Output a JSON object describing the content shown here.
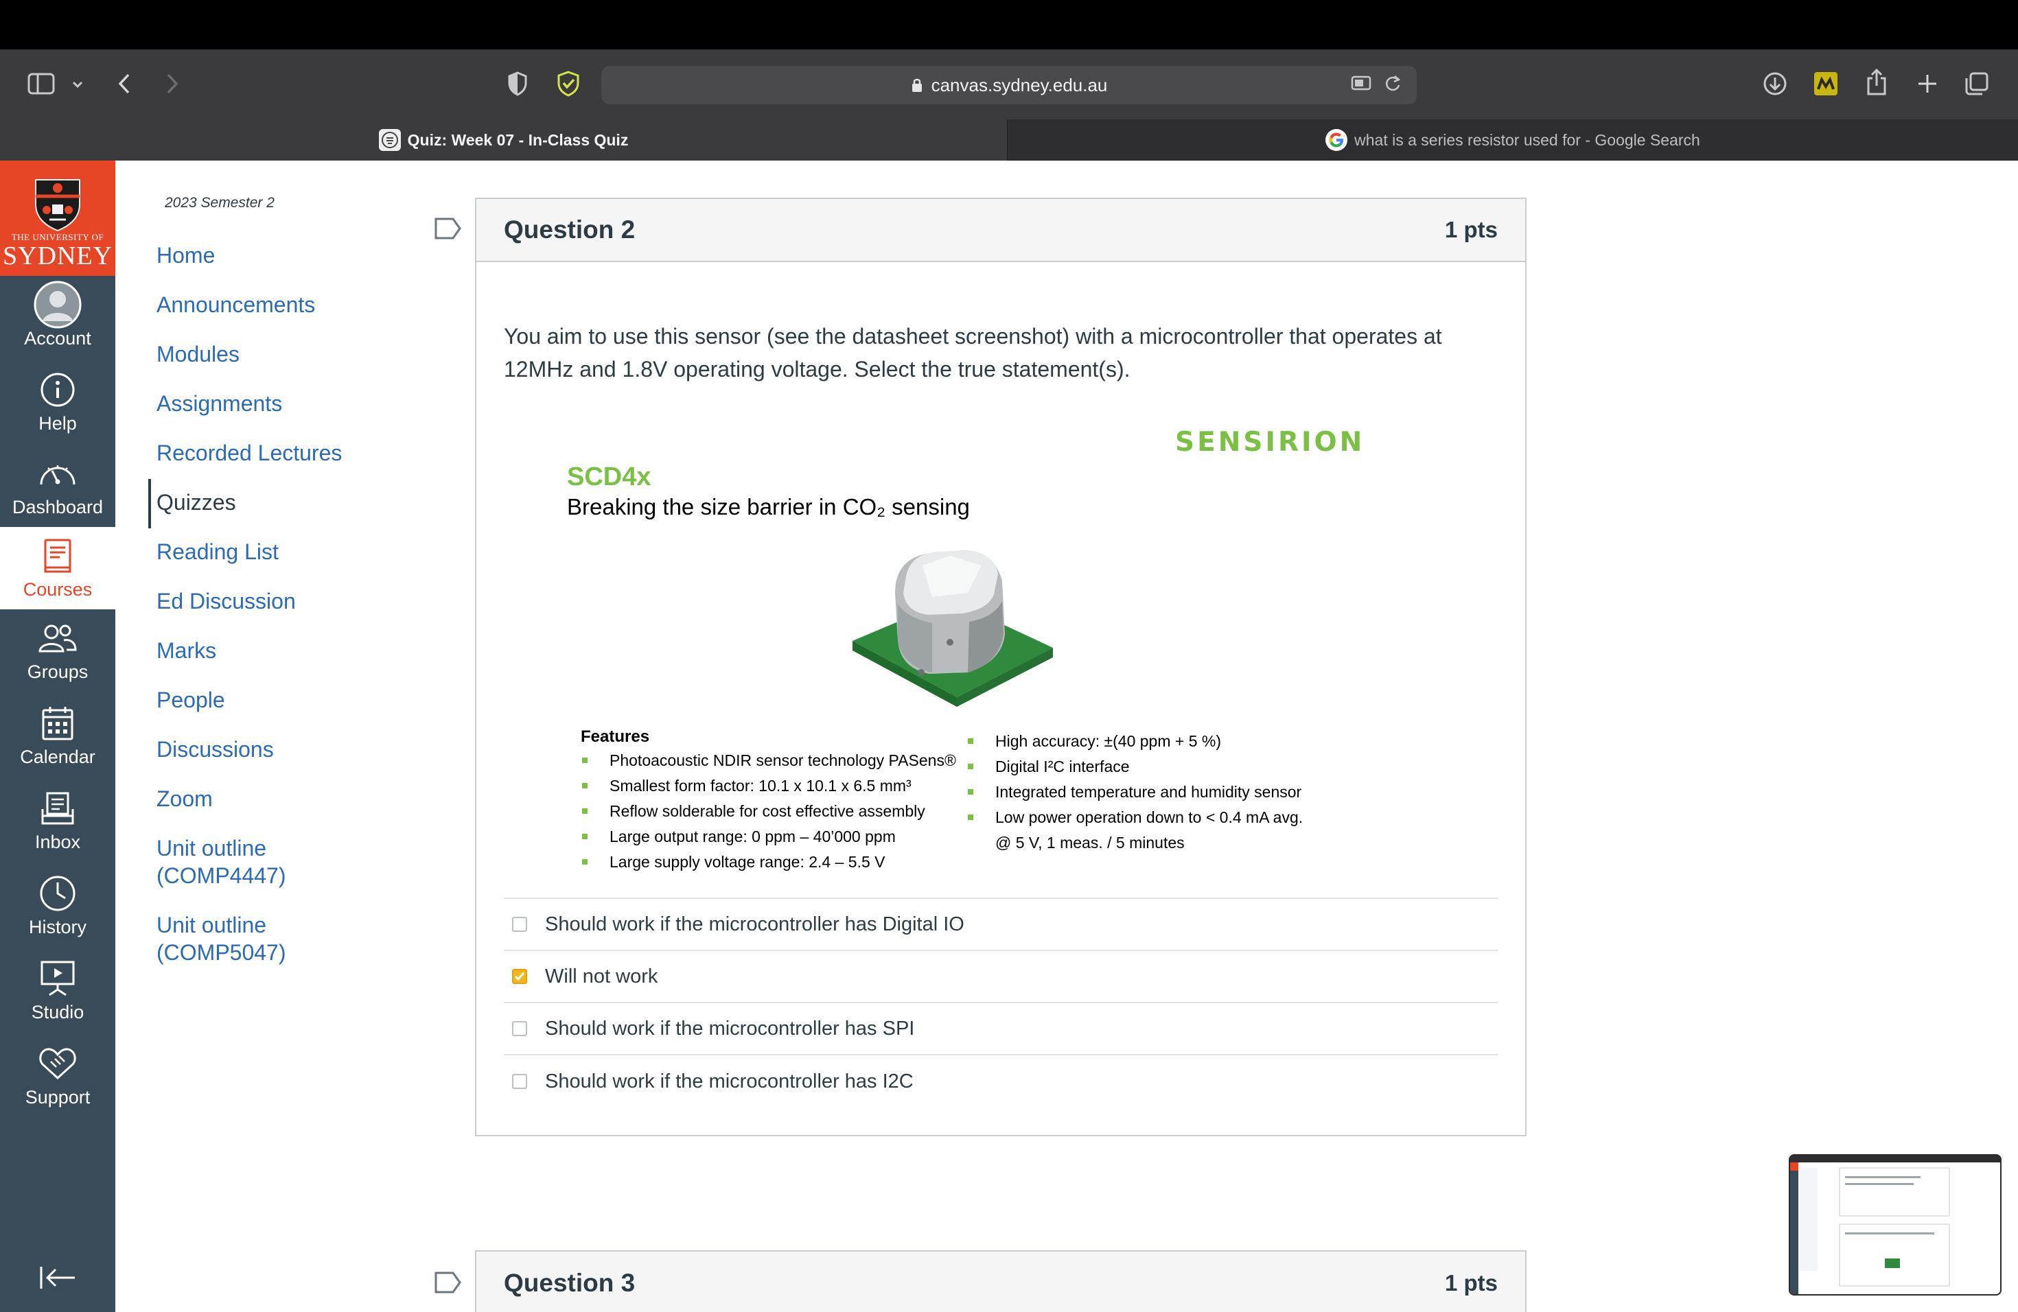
{
  "browser": {
    "url": "canvas.sydney.edu.au",
    "tabs": [
      {
        "label": "Quiz: Week 07 - In-Class Quiz",
        "active": true
      },
      {
        "label": "what is a series resistor used for - Google Search",
        "active": false
      }
    ]
  },
  "global_nav": {
    "logo_small": "THE UNIVERSITY OF",
    "logo_big": "SYDNEY",
    "items": [
      {
        "label": "Account",
        "icon": "account-avatar-icon"
      },
      {
        "label": "Help",
        "icon": "help-icon"
      },
      {
        "label": "Dashboard",
        "icon": "dashboard-icon"
      },
      {
        "label": "Courses",
        "icon": "courses-icon",
        "active": true
      },
      {
        "label": "Groups",
        "icon": "groups-icon"
      },
      {
        "label": "Calendar",
        "icon": "calendar-icon"
      },
      {
        "label": "Inbox",
        "icon": "inbox-icon"
      },
      {
        "label": "History",
        "icon": "history-icon"
      },
      {
        "label": "Studio",
        "icon": "studio-icon"
      },
      {
        "label": "Support",
        "icon": "support-icon"
      }
    ],
    "accent": "#e64626",
    "background": "#394b58"
  },
  "course_nav": {
    "term": "2023 Semester 2",
    "items": [
      {
        "label": "Home"
      },
      {
        "label": "Announcements"
      },
      {
        "label": "Modules"
      },
      {
        "label": "Assignments"
      },
      {
        "label": "Recorded Lectures"
      },
      {
        "label": "Quizzes",
        "active": true
      },
      {
        "label": "Reading List"
      },
      {
        "label": "Ed Discussion"
      },
      {
        "label": "Marks"
      },
      {
        "label": "People"
      },
      {
        "label": "Discussions"
      },
      {
        "label": "Zoom"
      },
      {
        "label": "Unit outline (COMP4447)"
      },
      {
        "label": "Unit outline (COMP5047)"
      }
    ]
  },
  "question2": {
    "title": "Question 2",
    "points": "1 pts",
    "text": "You aim to use this sensor (see the datasheet screenshot) with a microcontroller that operates at 12MHz and 1.8V operating voltage. Select the true statement(s).",
    "datasheet": {
      "brand": "SENSIRION",
      "product": "SCD4x",
      "tagline": "Breaking the size barrier in CO₂ sensing",
      "features_heading": "Features",
      "features_left": [
        "Photoacoustic NDIR sensor technology PASens®",
        "Smallest form factor: 10.1 x 10.1 x 6.5 mm³",
        "Reflow solderable for cost effective assembly",
        "Large output range: 0 ppm – 40’000 ppm",
        "Large supply voltage range: 2.4 – 5.5 V"
      ],
      "features_right": [
        "High accuracy: ±(40 ppm + 5 %)",
        "Digital I²C interface",
        "Integrated temperature and humidity sensor",
        "Low power operation down to < 0.4 mA avg.",
        "@ 5 V, 1 meas. / 5 minutes"
      ],
      "brand_color": "#7ac143"
    },
    "answers": [
      {
        "label": "Should work if the microcontroller has Digital IO",
        "checked": false
      },
      {
        "label": "Will not work",
        "checked": true
      },
      {
        "label": "Should work if the microcontroller has SPI",
        "checked": false
      },
      {
        "label": "Should work if the microcontroller has I2C",
        "checked": false
      }
    ]
  },
  "question3": {
    "title": "Question 3",
    "points": "1 pts"
  }
}
